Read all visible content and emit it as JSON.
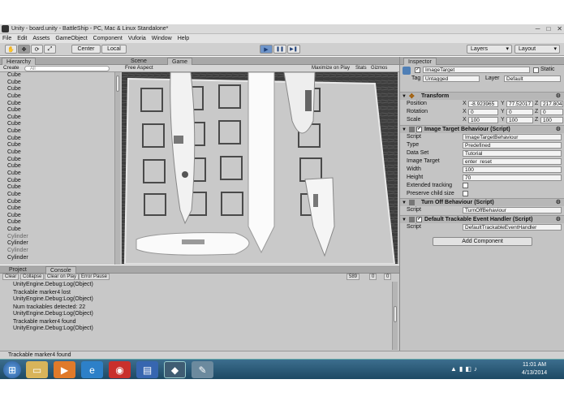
{
  "window": {
    "title": "Unity - board.unity - BattleShip - PC, Mac & Linux Standalone*",
    "controls": [
      "─",
      "□",
      "✕"
    ]
  },
  "menu": [
    "File",
    "Edit",
    "Assets",
    "GameObject",
    "Component",
    "Vuforia",
    "Window",
    "Help"
  ],
  "toolbar": {
    "tools": [
      "✋",
      "✥",
      "⟳",
      "⤢"
    ],
    "pivot": "Center",
    "space": "Local",
    "play": "▶",
    "pause": "❚❚",
    "step": "▶❚",
    "layers": "Layers",
    "layout": "Layout"
  },
  "hierarchy": {
    "tab": "Hierarchy",
    "create": "Create",
    "search": "All",
    "items": [
      "Cube",
      "Cube",
      "Cube",
      "Cube",
      "Cube",
      "Cube",
      "Cube",
      "Cube",
      "Cube",
      "Cube",
      "Cube",
      "Cube",
      "Cube",
      "Cube",
      "Cube",
      "Cube",
      "Cube",
      "Cube",
      "Cube",
      "Cube",
      "Cube",
      "Cube",
      "Cube",
      "Cylinder",
      "Cylinder",
      "Cylinder",
      "Cylinder"
    ]
  },
  "sceneTabs": {
    "scene": "Scene",
    "game": "Game",
    "aspect": "Free Aspect",
    "maximize": "Maximize on Play",
    "stats": "Stats",
    "gizmos": "Gizmos"
  },
  "console": {
    "projectTab": "Project",
    "consoleTab": "Console",
    "buttons": [
      "Clear",
      "Collapse",
      "Clear on Play",
      "Error Pause"
    ],
    "counts": [
      "589",
      "0",
      "0"
    ],
    "lines": [
      "UnityEngine.Debug:Log(Object)",
      "Trackable marker4 lost",
      "UnityEngine.Debug:Log(Object)",
      "Num trackables detected: 22",
      "UnityEngine.Debug:Log(Object)",
      "Trackable marker4 found",
      "UnityEngine.Debug:Log(Object)"
    ]
  },
  "status": "Trackable marker4 found",
  "inspector": {
    "tab": "Inspector",
    "objectName": "ImageTarget",
    "staticLabel": "Static",
    "tagLabel": "Tag",
    "tag": "Untagged",
    "layerLabel": "Layer",
    "layer": "Default",
    "transform": {
      "title": "Transform",
      "position": {
        "label": "Position",
        "x": "-8.923965",
        "y": "77.52017",
        "z": "217.8048"
      },
      "rotation": {
        "label": "Rotation",
        "x": "0",
        "y": "0",
        "z": "0"
      },
      "scale": {
        "label": "Scale",
        "x": "100",
        "y": "100",
        "z": "100"
      }
    },
    "imageTarget": {
      "title": "Image Target Behaviour (Script)",
      "scriptLabel": "Script",
      "script": "ImageTargetBehaviour",
      "typeLabel": "Type",
      "type": "Predefined",
      "dataSetLabel": "Data Set",
      "dataSet": "Tutorial",
      "imageTargetLabel": "Image Target",
      "imageTarget": "enter_reset",
      "widthLabel": "Width",
      "width": "100",
      "heightLabel": "Height",
      "height": "70",
      "extendedLabel": "Extended tracking",
      "preserveLabel": "Preserve child size"
    },
    "turnOff": {
      "title": "Turn Off Behaviour (Script)",
      "scriptLabel": "Script",
      "script": "TurnOffBehaviour"
    },
    "defaultHandler": {
      "title": "Default Trackable Event Handler (Script)",
      "scriptLabel": "Script",
      "script": "DefaultTrackableEventHandler"
    },
    "addComponent": "Add Component"
  },
  "taskbar": {
    "time": "11:01 AM",
    "date": "4/13/2014"
  },
  "colors": {
    "accent": "#6f95c9",
    "panel": "#c2c2c2",
    "taskbar": "#2a5a78"
  }
}
